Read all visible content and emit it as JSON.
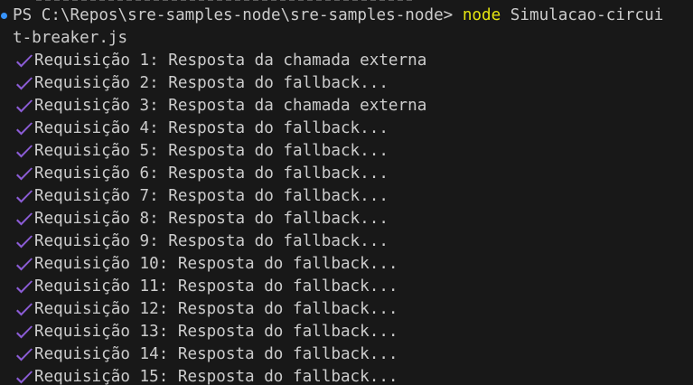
{
  "terminal": {
    "prompt": "PS C:\\Repos\\sre-samples-node\\sre-samples-node> ",
    "command": "node",
    "args_first": " Simulacao-circui",
    "args_wrap": "t-breaker.js",
    "check_icon": "check-icon",
    "check_color": "#8b5cd6",
    "lines": [
      "Requisição 1: Resposta da chamada externa",
      "Requisição 2: Resposta do fallback...",
      "Requisição 3: Resposta da chamada externa",
      "Requisição 4: Resposta do fallback...",
      "Requisição 5: Resposta do fallback...",
      "Requisição 6: Resposta do fallback...",
      "Requisição 7: Resposta do fallback...",
      "Requisição 8: Resposta do fallback...",
      "Requisição 9: Resposta do fallback...",
      "Requisição 10: Resposta do fallback...",
      "Requisição 11: Resposta do fallback...",
      "Requisição 12: Resposta do fallback...",
      "Requisição 13: Resposta do fallback...",
      "Requisição 14: Resposta do fallback...",
      "Requisição 15: Resposta do fallback..."
    ]
  }
}
